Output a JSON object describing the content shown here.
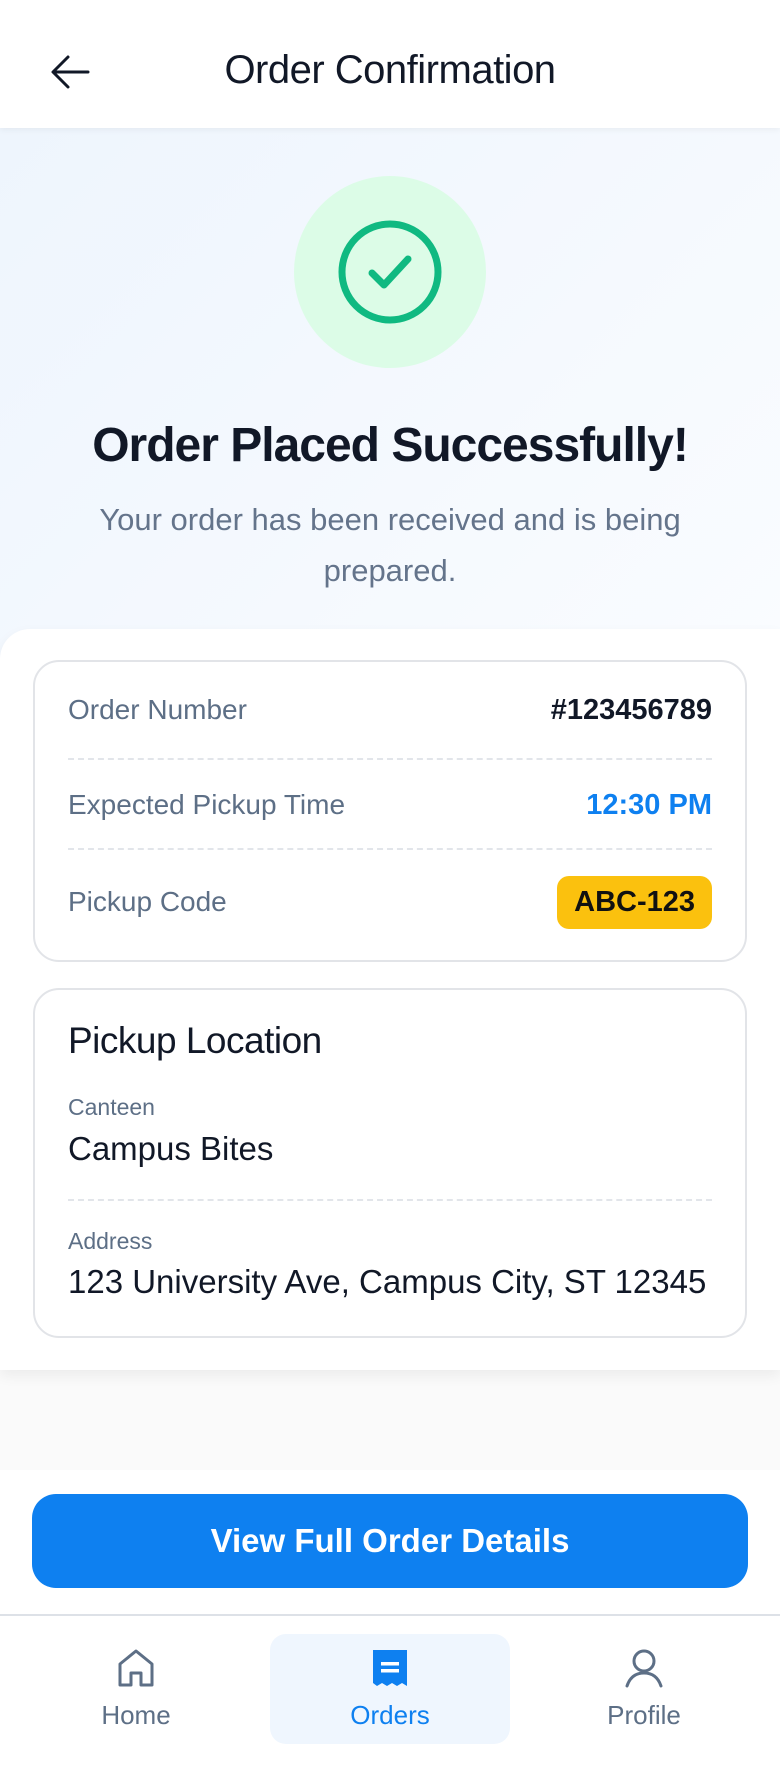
{
  "header": {
    "title": "Order Confirmation",
    "back_icon": "arrow-left-icon"
  },
  "hero": {
    "heading": "Order Placed Successfully!",
    "subtitle": "Your order has been received and is being prepared.",
    "icon": "check-circle-icon"
  },
  "order_card": {
    "order_number_label": "Order Number",
    "order_number": "#123456789",
    "pickup_time_label": "Expected Pickup Time",
    "pickup_time": "12:30 PM",
    "pickup_code_label": "Pickup Code",
    "pickup_code": "ABC-123"
  },
  "location_card": {
    "title": "Pickup Location",
    "canteen_label": "Canteen",
    "canteen": "Campus Bites",
    "address_label": "Address",
    "address": "123 University Ave, Campus City, ST 12345"
  },
  "actions": {
    "view_details": "View Full Order Details"
  },
  "nav": {
    "items": [
      {
        "label": "Home",
        "icon": "home-icon"
      },
      {
        "label": "Orders",
        "icon": "receipt-icon"
      },
      {
        "label": "Profile",
        "icon": "user-icon"
      }
    ],
    "active": "Orders"
  },
  "colors": {
    "accent": "#0e80f0",
    "success": "#10b981",
    "badge": "#fbc10e"
  }
}
